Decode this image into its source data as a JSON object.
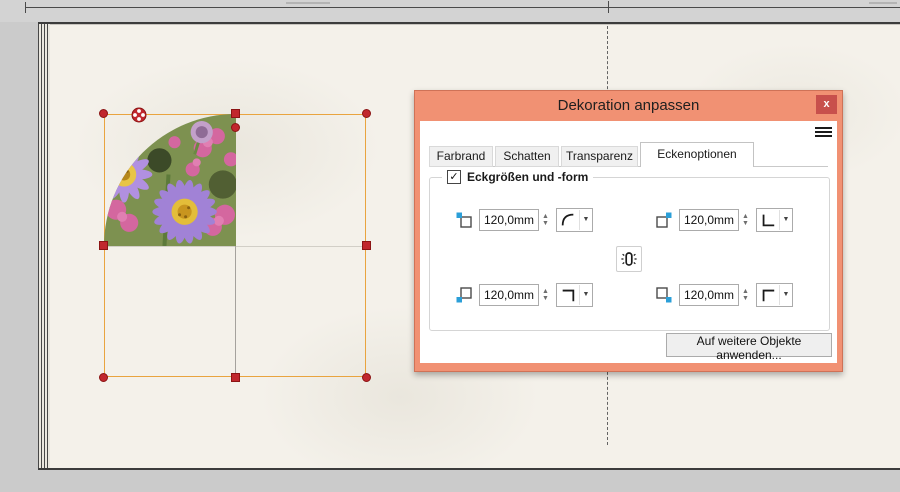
{
  "dialog": {
    "title": "Dekoration anpassen",
    "close_label": "x",
    "tabs": [
      {
        "label": "Farbrand",
        "active": false
      },
      {
        "label": "Schatten",
        "active": false
      },
      {
        "label": "Transparenz",
        "active": false
      },
      {
        "label": "Eckenoptionen",
        "active": true
      }
    ],
    "corner_group": {
      "label": "Eckgrößen und -form",
      "checkbox_checked": true,
      "corners": [
        {
          "position": "top-left",
          "value": "120,0mm",
          "shape": "rounded"
        },
        {
          "position": "top-right",
          "value": "120,0mm",
          "shape": "square"
        },
        {
          "position": "bottom-left",
          "value": "120,0mm",
          "shape": "square"
        },
        {
          "position": "bottom-right",
          "value": "120,0mm",
          "shape": "square"
        }
      ],
      "link_state": "unlinked"
    },
    "apply_button_label": "Auf weitere Objekte anwenden..."
  },
  "icons": {
    "check": "✓",
    "spin_up": "▲",
    "spin_down": "▼",
    "dropdown_arrow": "▼"
  },
  "colors": {
    "dialog_frame": "#f19173",
    "close_button": "#c8504c",
    "selection_outline": "#e9a43f",
    "handle_red": "#c1272d",
    "corner_icon_blue": "#2b9fd8",
    "page_background": "#f4f1ea"
  }
}
